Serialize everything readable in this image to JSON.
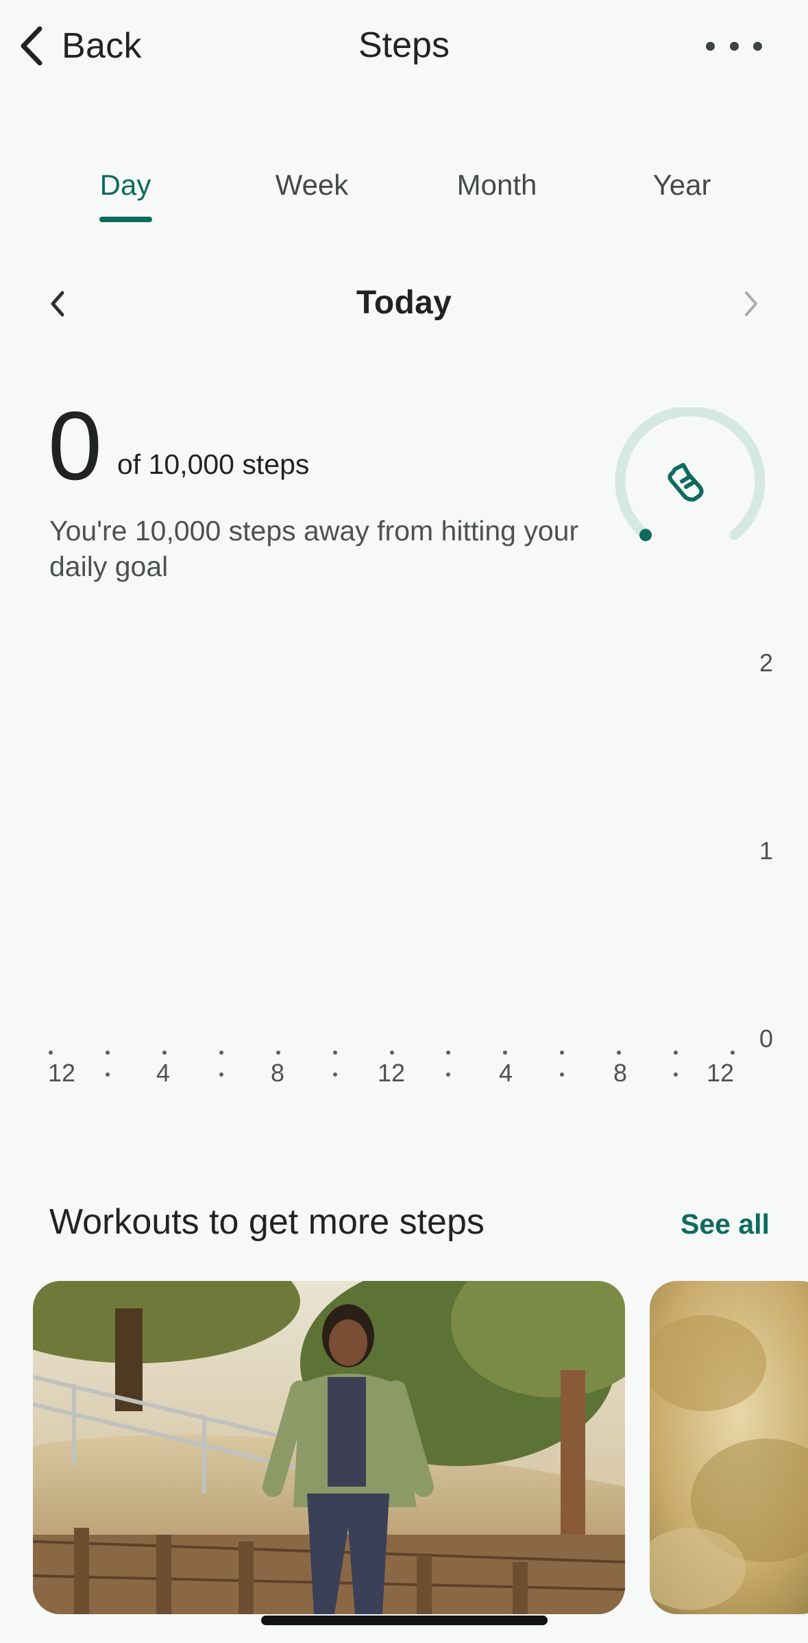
{
  "header": {
    "back_label": "Back",
    "title": "Steps"
  },
  "tabs": [
    {
      "label": "Day",
      "active": true
    },
    {
      "label": "Week",
      "active": false
    },
    {
      "label": "Month",
      "active": false
    },
    {
      "label": "Year",
      "active": false
    }
  ],
  "date_nav": {
    "label": "Today"
  },
  "summary": {
    "steps": "0",
    "goal_text": "of 10,000 steps",
    "message": "You're 10,000 steps away from hitting your daily goal",
    "progress_fraction": 0
  },
  "chart_data": {
    "type": "bar",
    "y_ticks": [
      "2",
      "1",
      "0"
    ],
    "x_ticks": [
      "12",
      "4",
      "8",
      "12",
      "4",
      "8",
      "12"
    ],
    "values": [],
    "ylim": [
      0,
      2
    ]
  },
  "workouts": {
    "title": "Workouts to get more steps",
    "see_all_label": "See all"
  },
  "colors": {
    "accent": "#0d6b5e",
    "ring_track": "#d5e8e1",
    "background": "#f6f9f7"
  }
}
